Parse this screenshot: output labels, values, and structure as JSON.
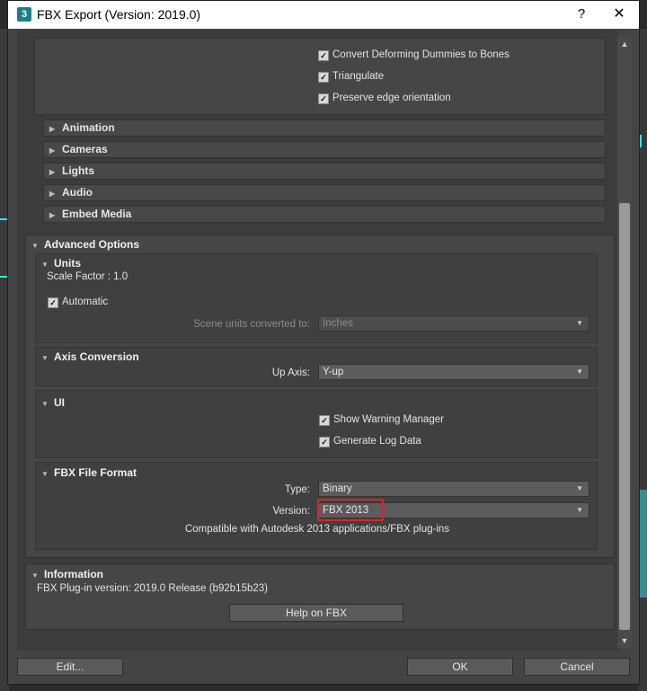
{
  "window": {
    "app_icon": "3",
    "title": "FBX Export (Version: 2019.0)",
    "help_label": "?",
    "close_label": "✕"
  },
  "geometry_options": {
    "convert_dummies": "Convert Deforming Dummies to Bones",
    "triangulate": "Triangulate",
    "preserve_edge": "Preserve edge orientation"
  },
  "collapsed_rollouts": [
    "Animation",
    "Cameras",
    "Lights",
    "Audio",
    "Embed Media"
  ],
  "advanced": {
    "title": "Advanced Options",
    "units": {
      "title": "Units",
      "scale_factor": "Scale Factor : 1.0",
      "automatic": "Automatic",
      "scene_units_label": "Scene units converted to:",
      "scene_units_value": "Inches"
    },
    "axis": {
      "title": "Axis Conversion",
      "up_axis_label": "Up Axis:",
      "up_axis_value": "Y-up"
    },
    "ui": {
      "title": "UI",
      "show_warning": "Show Warning Manager",
      "generate_log": "Generate Log Data"
    },
    "file_format": {
      "title": "FBX File Format",
      "type_label": "Type:",
      "type_value": "Binary",
      "version_label": "Version:",
      "version_value": "FBX 2013",
      "compat_text": "Compatible with Autodesk 2013 applications/FBX plug-ins"
    }
  },
  "information": {
    "title": "Information",
    "plugin_version": "FBX Plug-in version: 2019.0 Release (b92b15b23)",
    "help_button": "Help on FBX"
  },
  "footer": {
    "edit_button": "Edit...",
    "ok_button": "OK",
    "cancel_button": "Cancel"
  },
  "colors": {
    "highlight": "#e0212b",
    "viewport_accent": "#2ee6f0"
  }
}
